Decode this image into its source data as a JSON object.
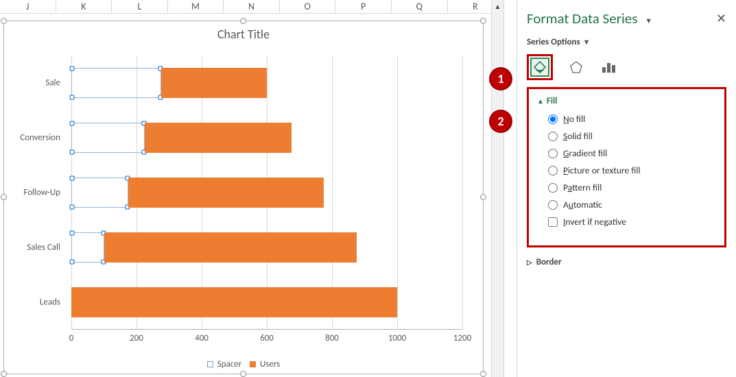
{
  "sheet": {
    "columns": [
      "J",
      "K",
      "L",
      "M",
      "N",
      "O",
      "P",
      "Q",
      "R"
    ]
  },
  "chart_data": {
    "type": "bar",
    "title": "Chart Title",
    "categories": [
      "Sale",
      "Conversion",
      "Follow-Up",
      "Sales Call",
      "Leads"
    ],
    "series": [
      {
        "name": "Spacer",
        "values": [
          275,
          225,
          175,
          100,
          0
        ],
        "color": null
      },
      {
        "name": "Users",
        "values": [
          325,
          450,
          600,
          775,
          1000
        ],
        "color": "#ed7d31"
      }
    ],
    "xlabel": "",
    "ylabel": "",
    "xticks": [
      0,
      200,
      400,
      600,
      800,
      1000,
      1200
    ],
    "xlim": [
      0,
      1200
    ],
    "selected_series": "Spacer",
    "legend": [
      "Spacer",
      "Users"
    ]
  },
  "pane": {
    "title": "Format Data Series",
    "section": "Series Options",
    "groups": {
      "fill": {
        "header": "Fill",
        "options": [
          "No fill",
          "Solid fill",
          "Gradient fill",
          "Picture or texture fill",
          "Pattern fill",
          "Automatic"
        ],
        "checkbox": "Invert if negative",
        "selected": "No fill"
      },
      "border": {
        "header": "Border"
      }
    }
  },
  "callouts": {
    "one": "1",
    "two": "2"
  }
}
